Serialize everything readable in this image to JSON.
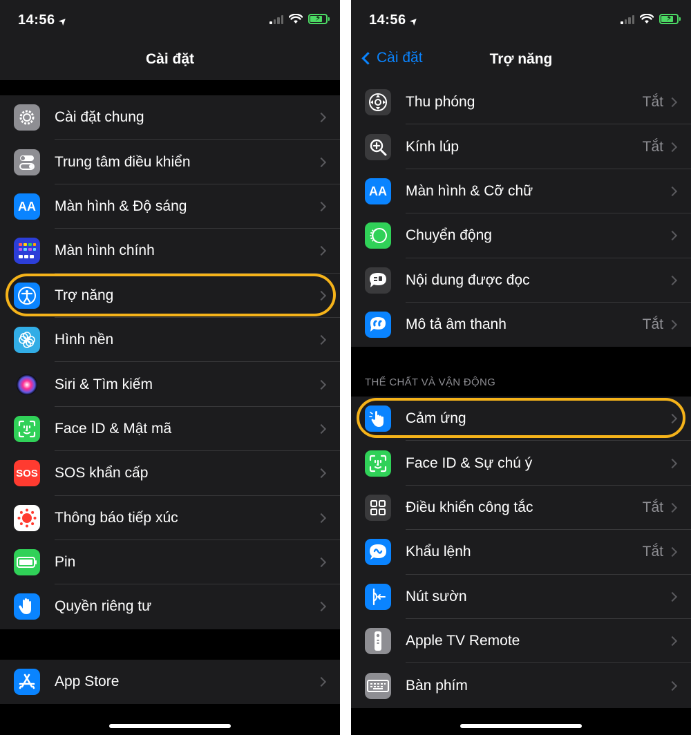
{
  "left": {
    "status": {
      "time": "14:56"
    },
    "nav": {
      "title": "Cài đặt"
    },
    "group1": [
      {
        "label": "Cài đặt chung",
        "icon": "gear-icon",
        "color": "#8e8e93"
      },
      {
        "label": "Trung tâm điều khiển",
        "icon": "toggles-icon",
        "color": "#8e8e93"
      },
      {
        "label": "Màn hình & Độ sáng",
        "icon": "text-size-icon",
        "color": "#0a84ff"
      },
      {
        "label": "Màn hình chính",
        "icon": "app-grid-icon",
        "color": "#2c3ed8"
      },
      {
        "label": "Trợ năng",
        "icon": "accessibility-icon",
        "color": "#0a84ff"
      },
      {
        "label": "Hình nền",
        "icon": "flower-icon",
        "color": "#32ade6"
      },
      {
        "label": "Siri & Tìm kiếm",
        "icon": "siri-icon",
        "color": "#1c1c1e"
      },
      {
        "label": "Face ID & Mật mã",
        "icon": "face-id-icon",
        "color": "#30d158"
      },
      {
        "label": "SOS khẩn cấp",
        "icon": "sos-icon",
        "color": "#ff3b30",
        "icon_text": "SOS"
      },
      {
        "label": "Thông báo tiếp xúc",
        "icon": "exposure-icon",
        "color": "#ffffff"
      },
      {
        "label": "Pin",
        "icon": "battery-icon",
        "color": "#30d158"
      },
      {
        "label": "Quyền riêng tư",
        "icon": "hand-icon",
        "color": "#0a84ff"
      }
    ],
    "group2": [
      {
        "label": "App Store",
        "icon": "app-store-icon",
        "color": "#0a84ff"
      }
    ]
  },
  "right": {
    "status": {
      "time": "14:56"
    },
    "nav": {
      "back_label": "Cài đặt",
      "title": "Trợ năng"
    },
    "group1": [
      {
        "label": "Thu phóng",
        "value": "Tắt",
        "icon": "zoom-icon",
        "color": "#3a3a3c"
      },
      {
        "label": "Kính lúp",
        "value": "Tắt",
        "icon": "magnifier-icon",
        "color": "#3a3a3c"
      },
      {
        "label": "Màn hình & Cỡ chữ",
        "value": "",
        "icon": "text-size-icon",
        "color": "#0a84ff"
      },
      {
        "label": "Chuyển động",
        "value": "",
        "icon": "motion-icon",
        "color": "#30d158"
      },
      {
        "label": "Nội dung được đọc",
        "value": "",
        "icon": "speech-icon",
        "color": "#3a3a3c"
      },
      {
        "label": "Mô tả âm thanh",
        "value": "Tắt",
        "icon": "audio-description-icon",
        "color": "#0a84ff"
      }
    ],
    "section_header": "THỂ CHẤT VÀ VẬN ĐỘNG",
    "group2": [
      {
        "label": "Cảm ứng",
        "value": "",
        "icon": "touch-icon",
        "color": "#0a84ff"
      },
      {
        "label": "Face ID & Sự chú ý",
        "value": "",
        "icon": "face-id-icon",
        "color": "#30d158"
      },
      {
        "label": "Điều khiển công tắc",
        "value": "Tắt",
        "icon": "switch-control-icon",
        "color": "#3a3a3c"
      },
      {
        "label": "Khẩu lệnh",
        "value": "Tắt",
        "icon": "voice-control-icon",
        "color": "#0a84ff"
      },
      {
        "label": "Nút sườn",
        "value": "",
        "icon": "side-button-icon",
        "color": "#0a84ff"
      },
      {
        "label": "Apple TV Remote",
        "value": "",
        "icon": "tv-remote-icon",
        "color": "#8e8e93"
      },
      {
        "label": "Bàn phím",
        "value": "",
        "icon": "keyboard-icon",
        "color": "#8e8e93"
      }
    ]
  },
  "highlight_color": "#f5b31a"
}
